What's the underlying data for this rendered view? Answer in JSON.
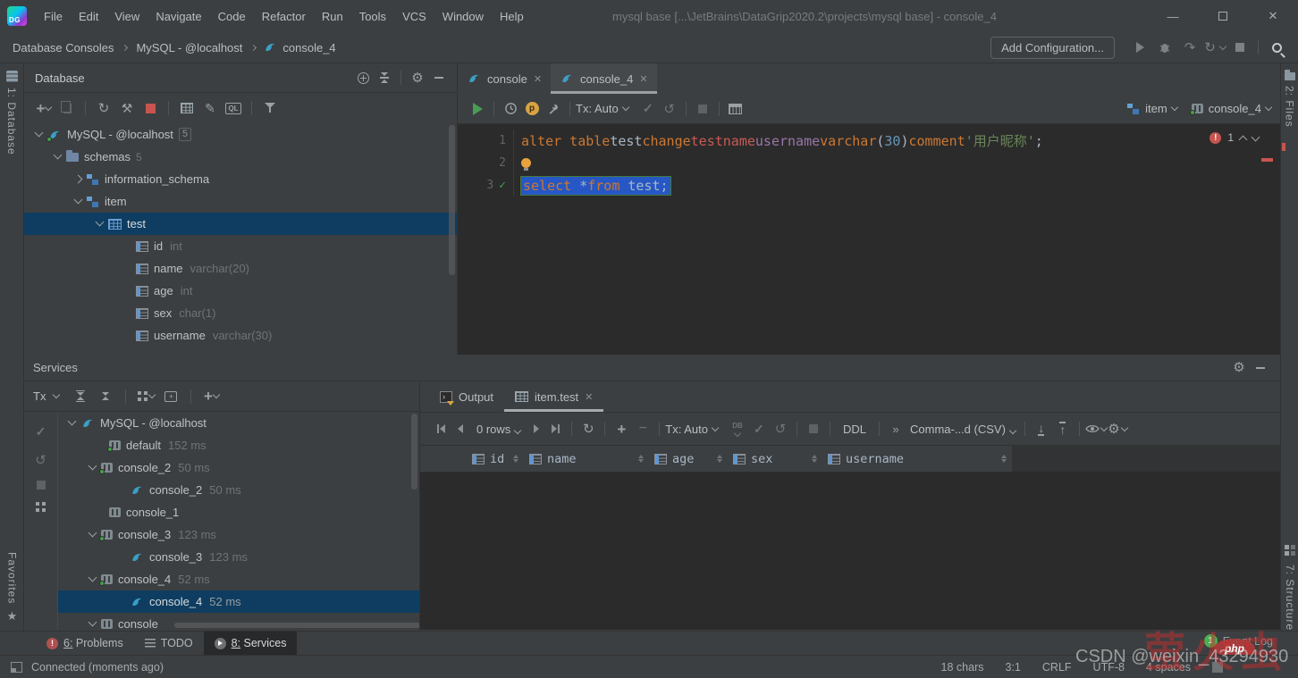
{
  "title_bar": {
    "menus": [
      "File",
      "Edit",
      "View",
      "Navigate",
      "Code",
      "Refactor",
      "Run",
      "Tools",
      "VCS",
      "Window",
      "Help"
    ],
    "title": "mysql base [...\\JetBrains\\DataGrip2020.2\\projects\\mysql base] - console_4"
  },
  "toolbar": {
    "breadcrumbs": [
      "Database Consoles",
      "MySQL - @localhost",
      "console_4"
    ],
    "add_configuration_label": "Add Configuration..."
  },
  "strips": {
    "left_top": "1: Database",
    "left_bottom": "Favorites",
    "right_top": "2: Files",
    "right_bottom": "7: Structure"
  },
  "database_panel": {
    "title": "Database",
    "ql_icon_label": "QL",
    "tree": [
      {
        "label": "MySQL - @localhost",
        "badge": "5"
      },
      {
        "label": "schemas",
        "badge": "5"
      },
      {
        "label": "information_schema"
      },
      {
        "label": "item"
      },
      {
        "label": "test"
      },
      {
        "label": "id",
        "type": "int"
      },
      {
        "label": "name",
        "type": "varchar(20)"
      },
      {
        "label": "age",
        "type": "int"
      },
      {
        "label": "sex",
        "type": "char(1)"
      },
      {
        "label": "username",
        "type": "varchar(30)"
      }
    ]
  },
  "services_panel": {
    "title": "Services",
    "tx_label": "Tx",
    "tree": [
      {
        "label": "MySQL - @localhost"
      },
      {
        "label": "default",
        "time": "152 ms"
      },
      {
        "label": "console_2",
        "time": "50 ms"
      },
      {
        "label": "console_2",
        "time": "50 ms"
      },
      {
        "label": "console_1"
      },
      {
        "label": "console_3",
        "time": "123 ms"
      },
      {
        "label": "console_3",
        "time": "123 ms"
      },
      {
        "label": "console_4",
        "time": "52 ms"
      },
      {
        "label": "console_4",
        "time": "52 ms"
      },
      {
        "label": "console"
      }
    ]
  },
  "editor": {
    "tabs": [
      {
        "label": "console"
      },
      {
        "label": "console_4"
      }
    ],
    "toolbar": {
      "tx_label": "Tx: Auto",
      "schema": "item",
      "console": "console_4",
      "p_icon_label": "p"
    },
    "error_count": "1",
    "lines": [
      {
        "num": "1",
        "tokens": [
          {
            "t": "alter table ",
            "c": "k"
          },
          {
            "t": "test ",
            "c": "p"
          },
          {
            "t": "change ",
            "c": "k"
          },
          {
            "t": "testname ",
            "c": "e"
          },
          {
            "t": "username ",
            "c": "f"
          },
          {
            "t": "varchar",
            "c": "k"
          },
          {
            "t": "(",
            "c": "p"
          },
          {
            "t": "30",
            "c": "n"
          },
          {
            "t": ") ",
            "c": "p"
          },
          {
            "t": "comment ",
            "c": "k"
          },
          {
            "t": "'用户昵称'",
            "c": "s"
          },
          {
            "t": ";",
            "c": "p"
          }
        ]
      },
      {
        "num": "2",
        "tokens": []
      },
      {
        "num": "3",
        "tokens": [
          {
            "t": "select ",
            "c": "k"
          },
          {
            "t": "*",
            "c": "p"
          },
          {
            "t": "from",
            "c": "k"
          },
          {
            "t": " test",
            "c": "p"
          },
          {
            "t": ";",
            "c": "p"
          }
        ]
      }
    ]
  },
  "results_panel": {
    "tabs": [
      {
        "label": "Output"
      },
      {
        "label": "item.test"
      }
    ],
    "toolbar": {
      "rows_label": "0 rows",
      "tx_label": "Tx: Auto",
      "db_icon_label": "DB",
      "ddl_label": "DDL",
      "format_label": "Comma-...d (CSV)"
    },
    "columns": [
      "id",
      "name",
      "age",
      "sex",
      "username"
    ]
  },
  "bottom_bar": {
    "tabs": [
      {
        "label": "6: Problems"
      },
      {
        "label": "TODO"
      },
      {
        "label": "8: Services"
      }
    ],
    "event_log_label": "Event Log",
    "notification_count": "1"
  },
  "status_bar": {
    "connection": "Connected (moments ago)",
    "chars": "18 chars",
    "position": "3:1",
    "line_ending": "CRLF",
    "encoding": "UTF-8",
    "indent": "4 spaces"
  },
  "watermarks": {
    "csdn": "CSDN @weixin_43294930",
    "php": "php",
    "red_text": "萤火虫"
  },
  "colors": {
    "bg": "#3c3f41",
    "editor_bg": "#2b2b2b",
    "selection": "#0e3d61",
    "keyword": "#cc7832",
    "unresolved": "#c75b56",
    "identifier": "#9876aa",
    "number": "#6897bb",
    "string": "#6a8759",
    "run_green": "#499c54",
    "stop_red": "#c75450",
    "icon_blue": "#62a0d8",
    "dolphin_blue": "#3a9fc6"
  }
}
